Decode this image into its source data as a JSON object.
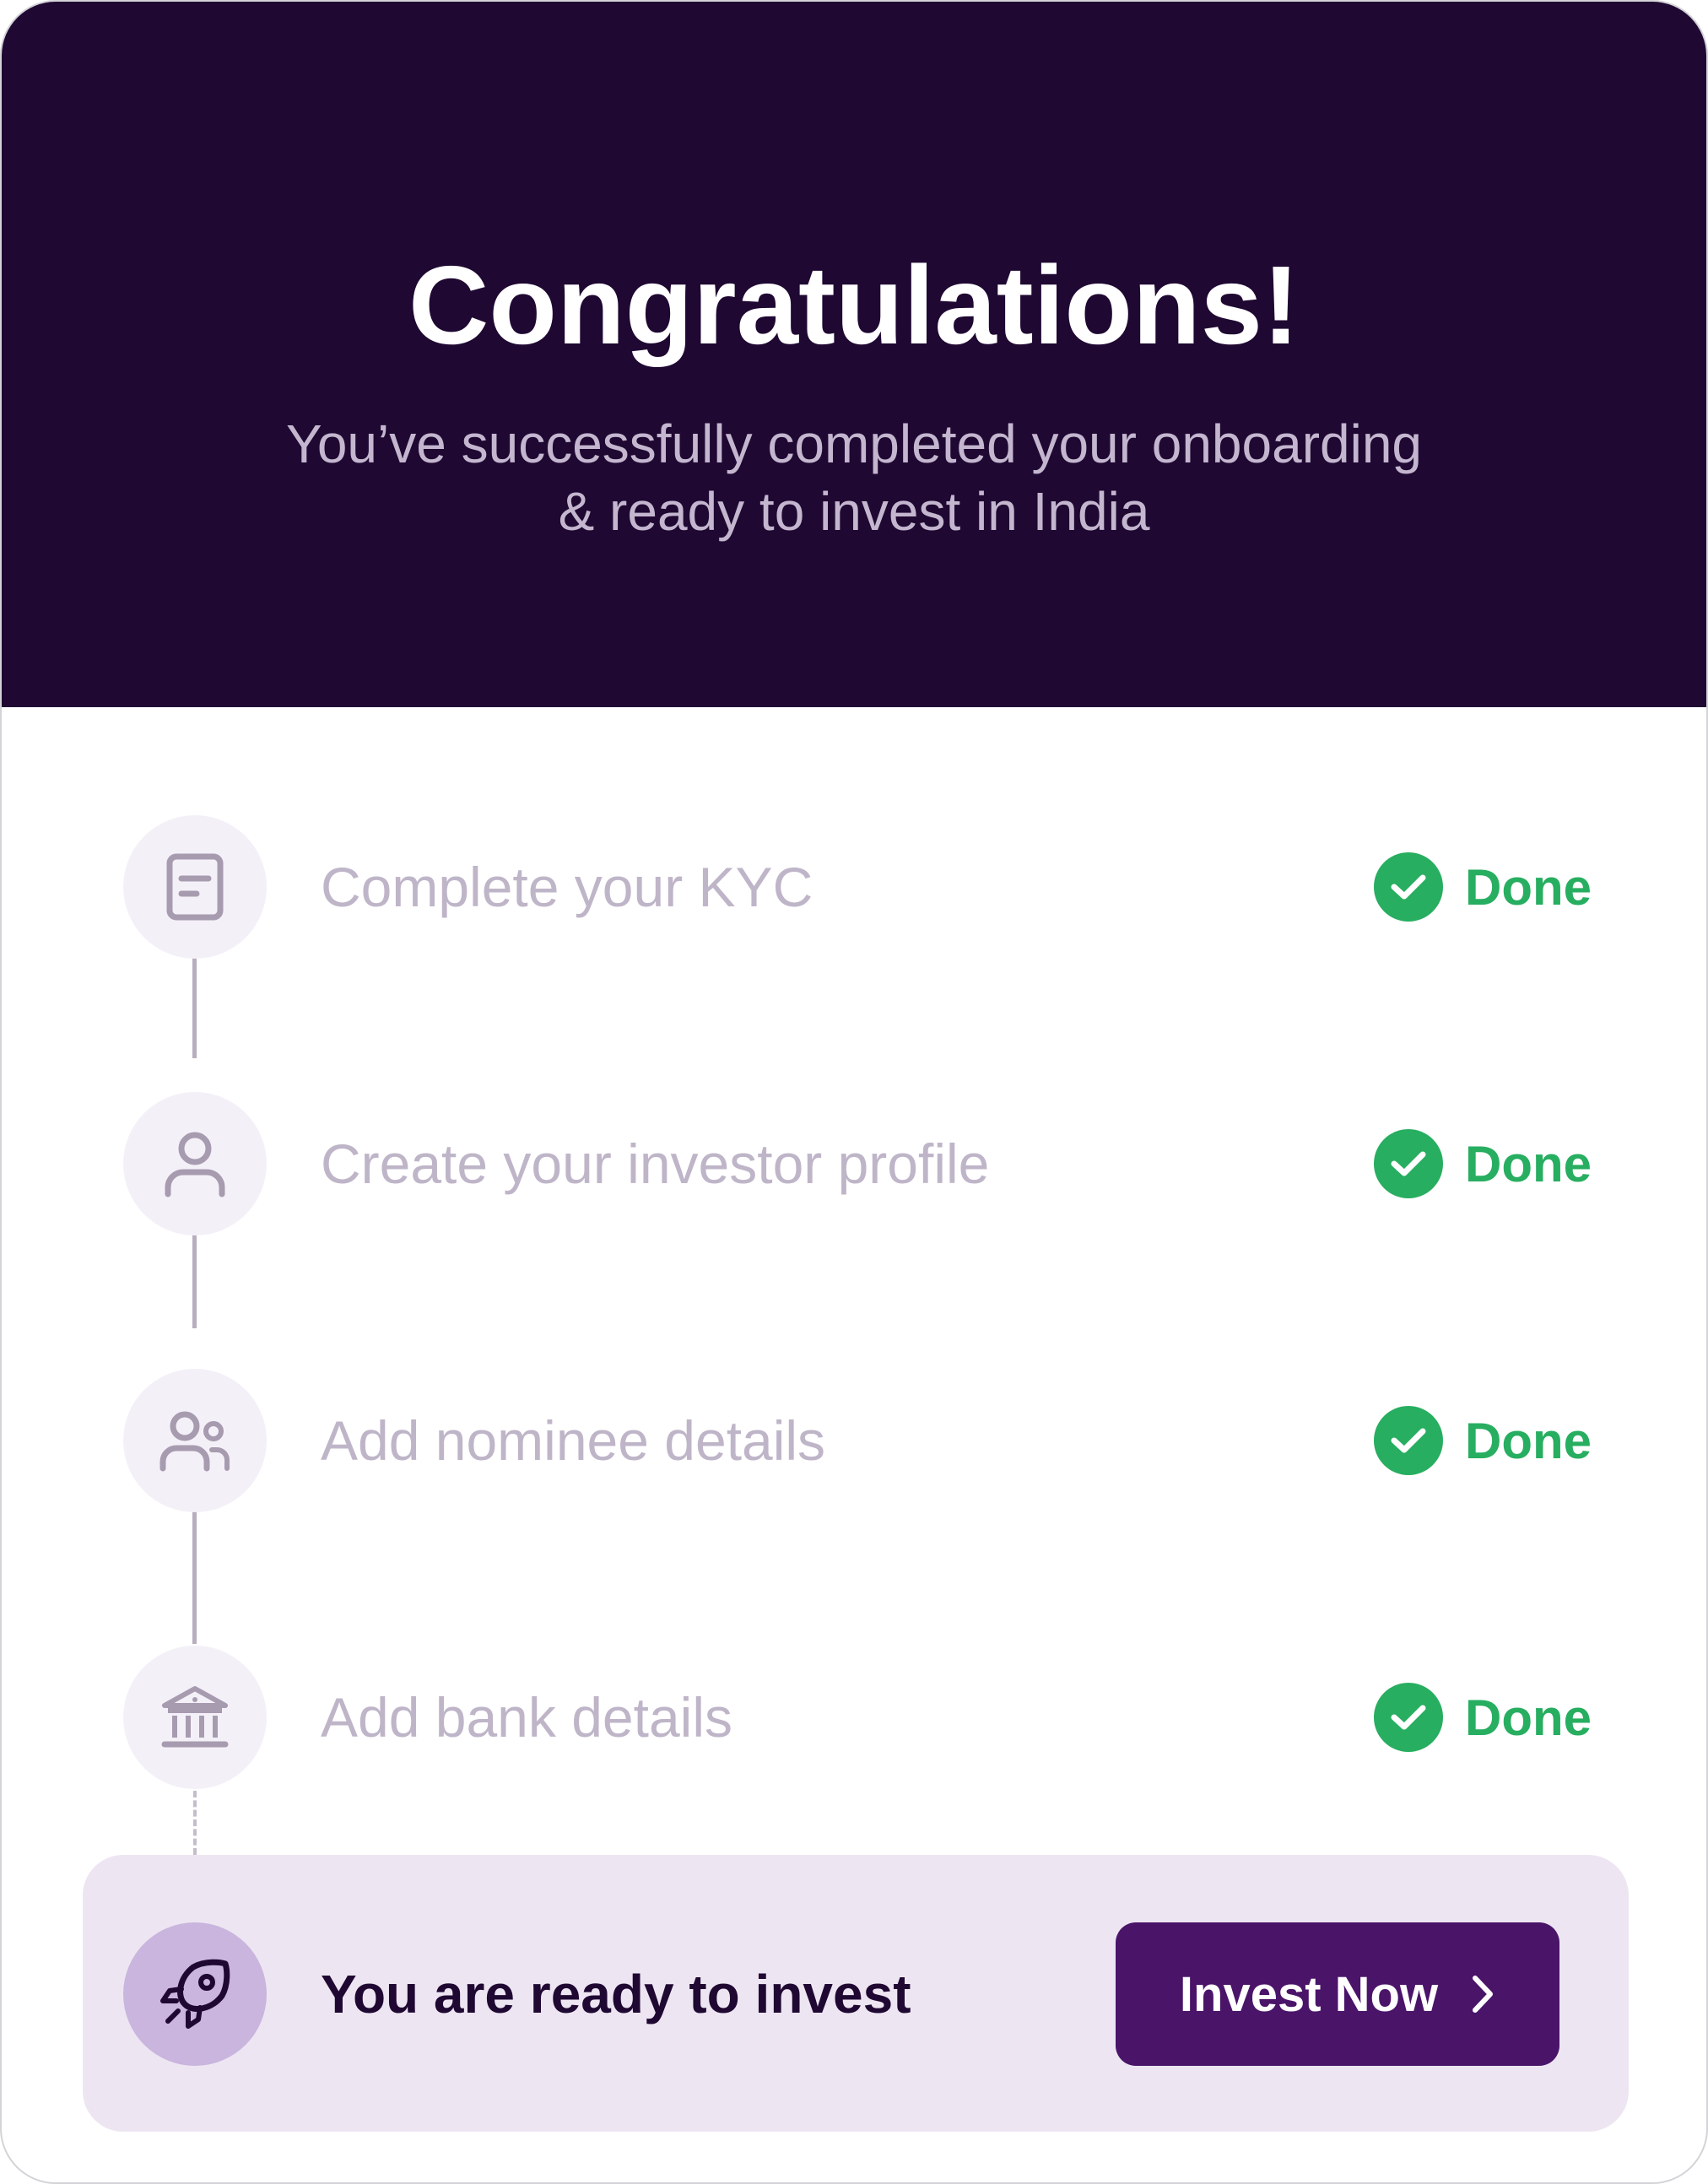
{
  "header": {
    "title": "Congratulations!",
    "subtitle_line1": "You’ve successfully completed your onboarding",
    "subtitle_line2": "& ready to invest in India"
  },
  "steps": [
    {
      "label": "Complete your KYC",
      "status": "Done",
      "icon": "document-icon"
    },
    {
      "label": "Create your investor profile",
      "status": "Done",
      "icon": "user-icon"
    },
    {
      "label": "Add nominee details",
      "status": "Done",
      "icon": "users-icon"
    },
    {
      "label": "Add bank details",
      "status": "Done",
      "icon": "bank-icon"
    }
  ],
  "ready": {
    "icon": "rocket-icon",
    "text": "You are ready to invest",
    "button_label": "Invest Now"
  },
  "colors": {
    "header_bg": "#1f0832",
    "success": "#27ae60",
    "button_bg": "#4a1469",
    "panel_bg": "#ede6f2"
  }
}
